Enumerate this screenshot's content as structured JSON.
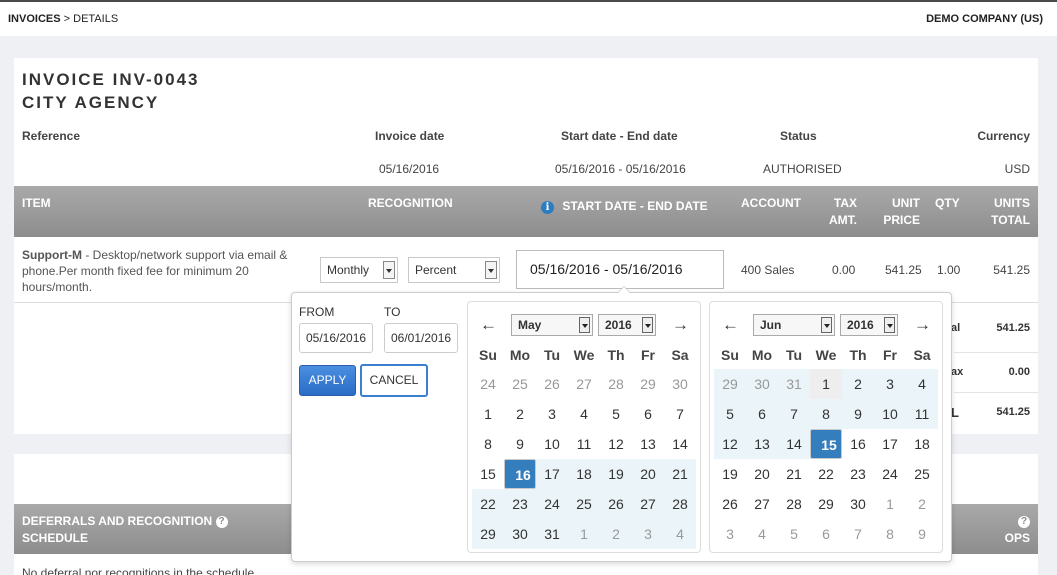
{
  "breadcrumb": {
    "parent": "INVOICES",
    "separator": " > ",
    "current": "DETAILS"
  },
  "company": "DEMO COMPANY (US)",
  "invoice": {
    "title_line1": "INVOICE INV-0043",
    "title_line2": "CITY AGENCY",
    "meta_headers": [
      "Reference",
      "Invoice date",
      "Start date - End date",
      "Status",
      "Currency"
    ],
    "meta_values": [
      "",
      "05/16/2016",
      "05/16/2016 - 05/16/2016",
      "AUTHORISED",
      "USD"
    ]
  },
  "table": {
    "headers": {
      "item": "ITEM",
      "recognition": "RECOGNITION",
      "dates": "START DATE - END DATE",
      "account": "ACCOUNT",
      "tax1": "TAX",
      "tax2": "AMT.",
      "price1": "UNIT",
      "price2": "PRICE",
      "qty": "QTY",
      "total1": "UNITS",
      "total2": "TOTAL"
    },
    "info_icon": "i",
    "row": {
      "item_name": "Support-M",
      "item_desc": " - Desktop/network support via email & phone.Per month fixed fee for minimum 20 hours/month.",
      "frequency": "Monthly",
      "method": "Percent",
      "daterange": "05/16/2016 - 05/16/2016",
      "account": "400 Sales",
      "tax": "0.00",
      "unit_price": "541.25",
      "qty": "1.00",
      "total": "541.25"
    }
  },
  "totals": {
    "l1": "al",
    "v1": "541.25",
    "l2": "ax",
    "v2": "0.00",
    "l3": "L",
    "v3": "541.25"
  },
  "deferrals": {
    "title1": "DEFERRALS AND RECOGNITION",
    "title2": "SCHEDULE",
    "ops": "OPS",
    "empty": "No deferral nor recognitions in the schedule"
  },
  "picker": {
    "from_label": "FROM",
    "to_label": "TO",
    "from_value": "05/16/2016",
    "to_value": "06/01/2016",
    "apply": "APPLY",
    "cancel": "CANCEL",
    "dow": [
      "Su",
      "Mo",
      "Tu",
      "We",
      "Th",
      "Fr",
      "Sa"
    ],
    "left": {
      "month": "May",
      "year": "2016",
      "weeks": [
        [
          "24",
          "25",
          "26",
          "27",
          "28",
          "29",
          "30"
        ],
        [
          "1",
          "2",
          "3",
          "4",
          "5",
          "6",
          "7"
        ],
        [
          "8",
          "9",
          "10",
          "11",
          "12",
          "13",
          "14"
        ],
        [
          "15",
          "16",
          "17",
          "18",
          "19",
          "20",
          "21"
        ],
        [
          "22",
          "23",
          "24",
          "25",
          "26",
          "27",
          "28"
        ],
        [
          "29",
          "30",
          "31",
          "1",
          "2",
          "3",
          "4"
        ]
      ]
    },
    "right": {
      "month": "Jun",
      "year": "2016",
      "weeks": [
        [
          "29",
          "30",
          "31",
          "1",
          "2",
          "3",
          "4"
        ],
        [
          "5",
          "6",
          "7",
          "8",
          "9",
          "10",
          "11"
        ],
        [
          "12",
          "13",
          "14",
          "15",
          "16",
          "17",
          "18"
        ],
        [
          "19",
          "20",
          "21",
          "22",
          "23",
          "24",
          "25"
        ],
        [
          "26",
          "27",
          "28",
          "29",
          "30",
          "1",
          "2"
        ],
        [
          "3",
          "4",
          "5",
          "6",
          "7",
          "8",
          "9"
        ]
      ]
    }
  },
  "colors": {
    "accent": "#357ebd",
    "header_bg": "#999999",
    "range_bg": "#ebf4f8"
  }
}
